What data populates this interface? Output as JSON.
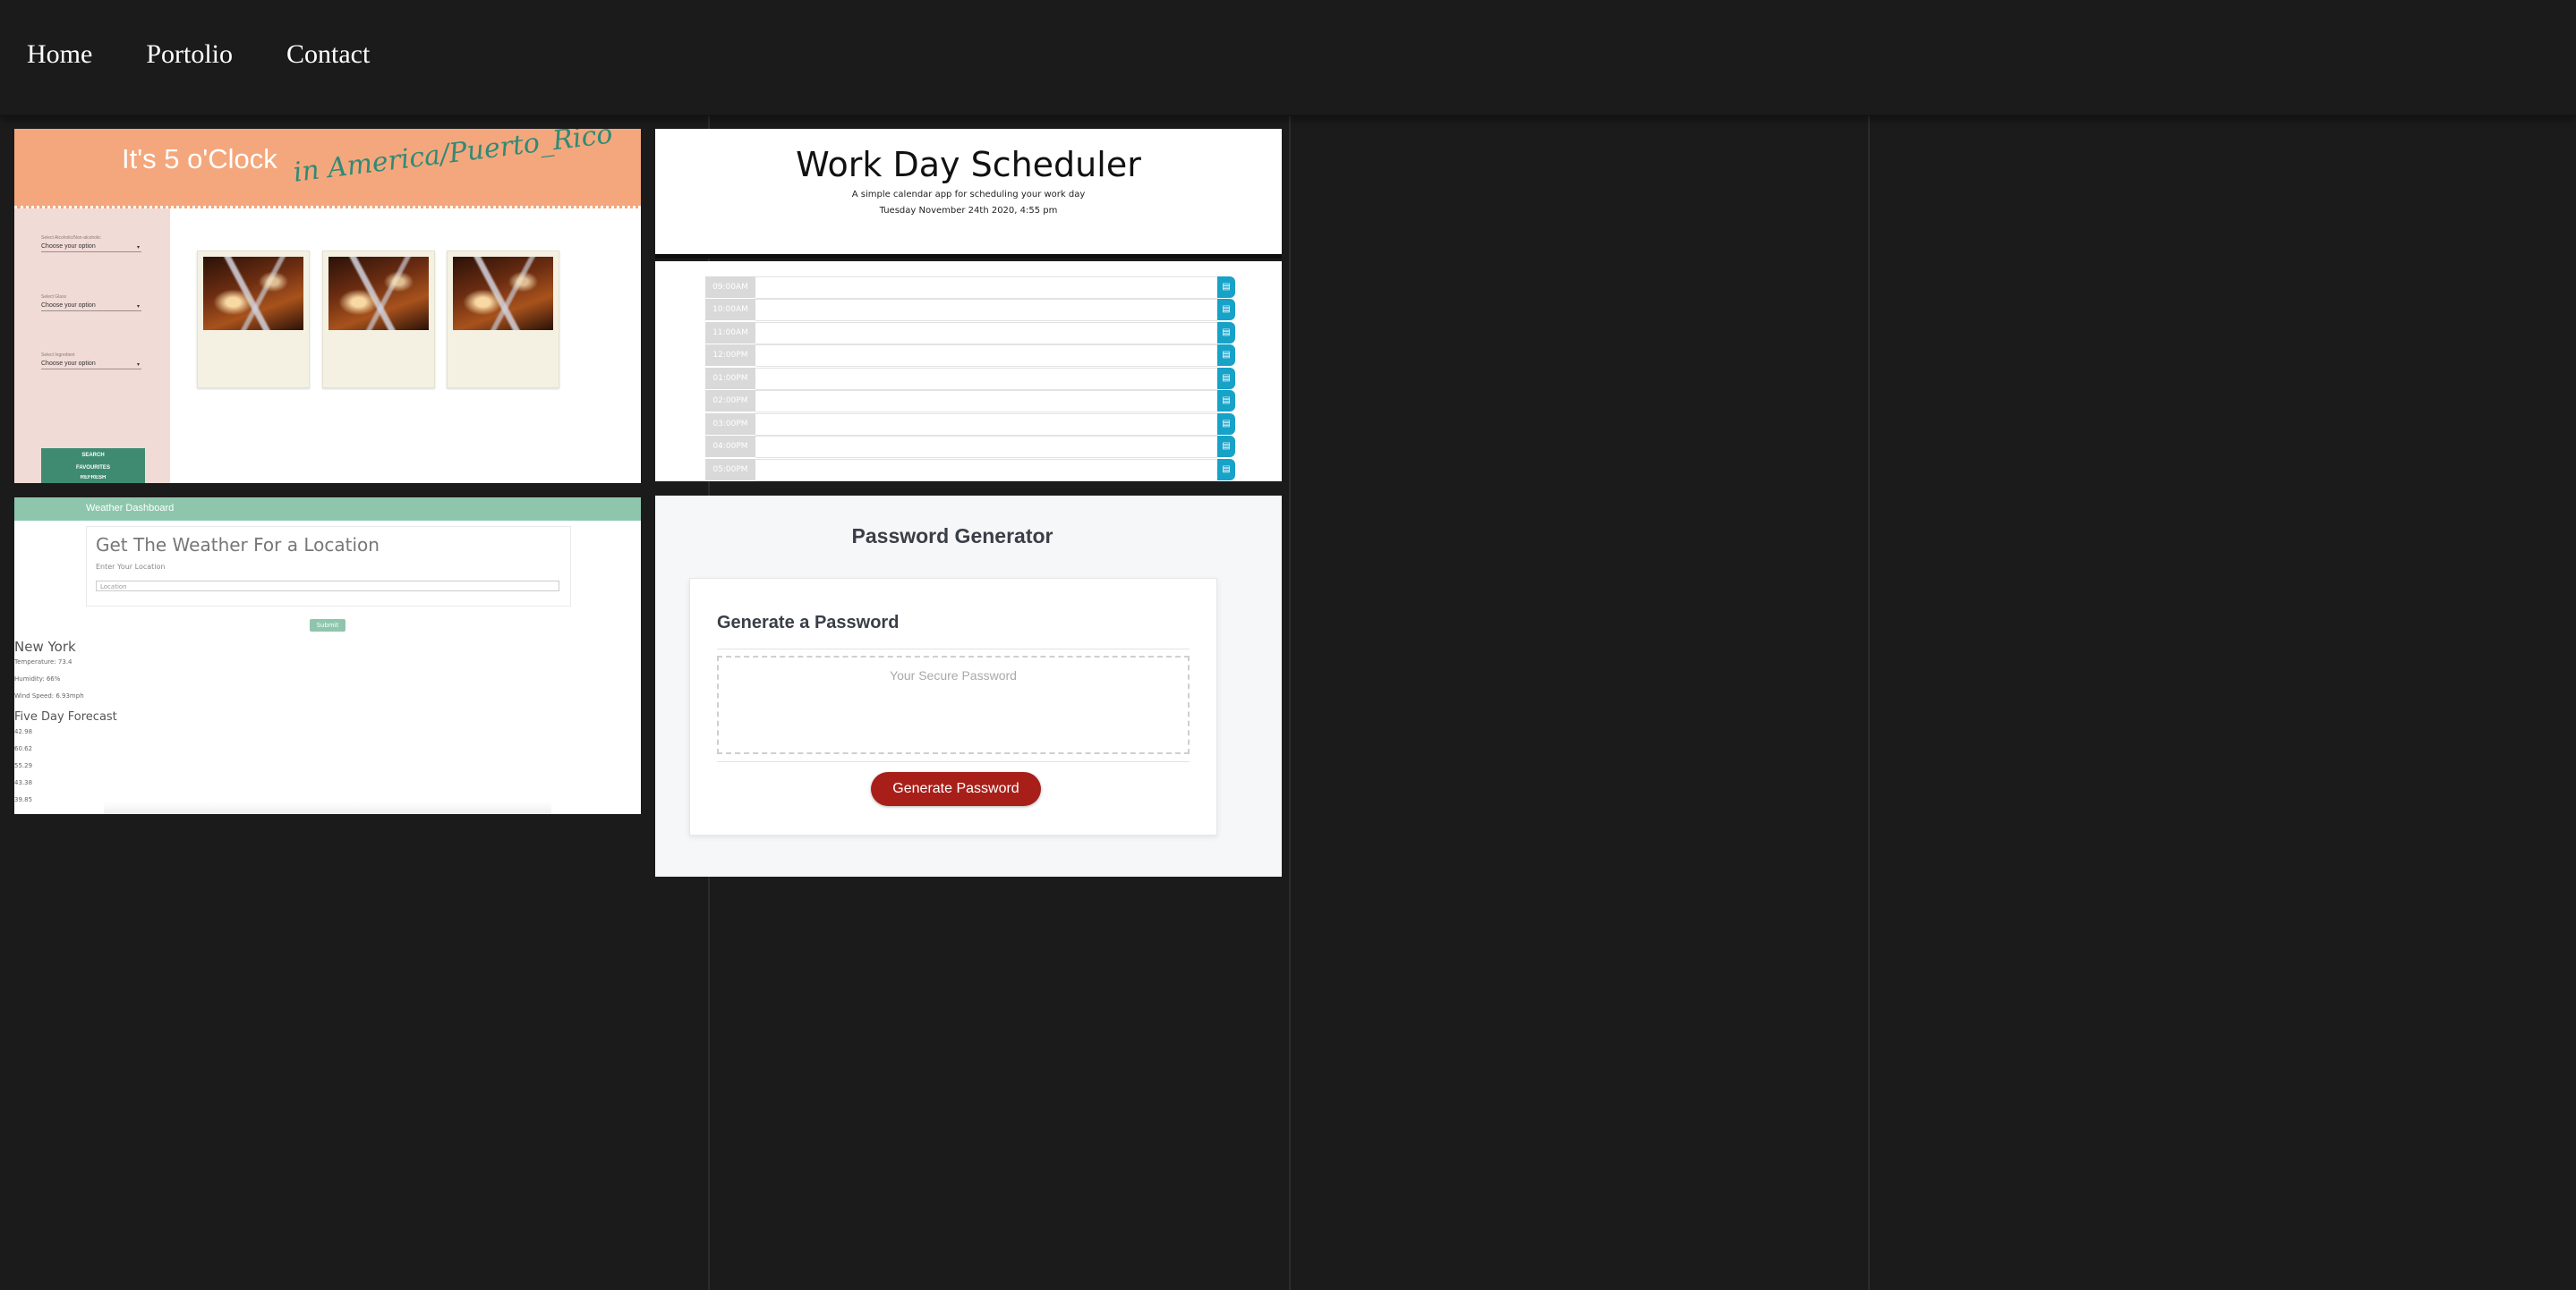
{
  "nav": {
    "items": [
      "Home",
      "Portolio",
      "Contact"
    ]
  },
  "five_oclock": {
    "title": "It's 5 o'Clock",
    "subtitle": "in America/Puerto_Rico",
    "fields": [
      {
        "label": "Select Alcoholic/Non-alcoholic",
        "value": "Choose your option"
      },
      {
        "label": "Select Glass",
        "value": "Choose your option"
      },
      {
        "label": "Select Ingredient",
        "value": "Choose your option"
      }
    ],
    "buttons": [
      "SEARCH",
      "REFRESH",
      "FAVOURITES"
    ]
  },
  "scheduler": {
    "title": "Work Day Scheduler",
    "subtitle": "A simple calendar app for scheduling your work day",
    "date": "Tuesday November 24th 2020, 4:55 pm",
    "hours": [
      "09:00AM",
      "10:00AM",
      "11:00AM",
      "12:00PM",
      "01:00PM",
      "02:00PM",
      "03:00PM",
      "04:00PM",
      "05:00PM"
    ]
  },
  "weather": {
    "brand": "Weather Dashboard",
    "heading": "Get The Weather For a Location",
    "input_label": "Enter Your Location",
    "input_placeholder": "Location",
    "submit": "Submit",
    "city": "New York",
    "stats": [
      "Temperature: 73.4",
      "Humidity: 66%",
      "Wind Speed: 6.93mph"
    ],
    "forecast_title": "Five Day Forecast",
    "forecast": [
      "42.98",
      "60.62",
      "55.29",
      "43.38",
      "39.85"
    ]
  },
  "password": {
    "page_title": "Password Generator",
    "card_title": "Generate a Password",
    "placeholder": "Your Secure Password",
    "button": "Generate Password"
  },
  "colors": {
    "page_bg": "#1b1b1b",
    "five_header": "#f4a77c",
    "five_button": "#3f8b72",
    "schedule_save": "#17a2c8",
    "weather_accent": "#8ec6ad",
    "password_button": "#a81f1a"
  }
}
